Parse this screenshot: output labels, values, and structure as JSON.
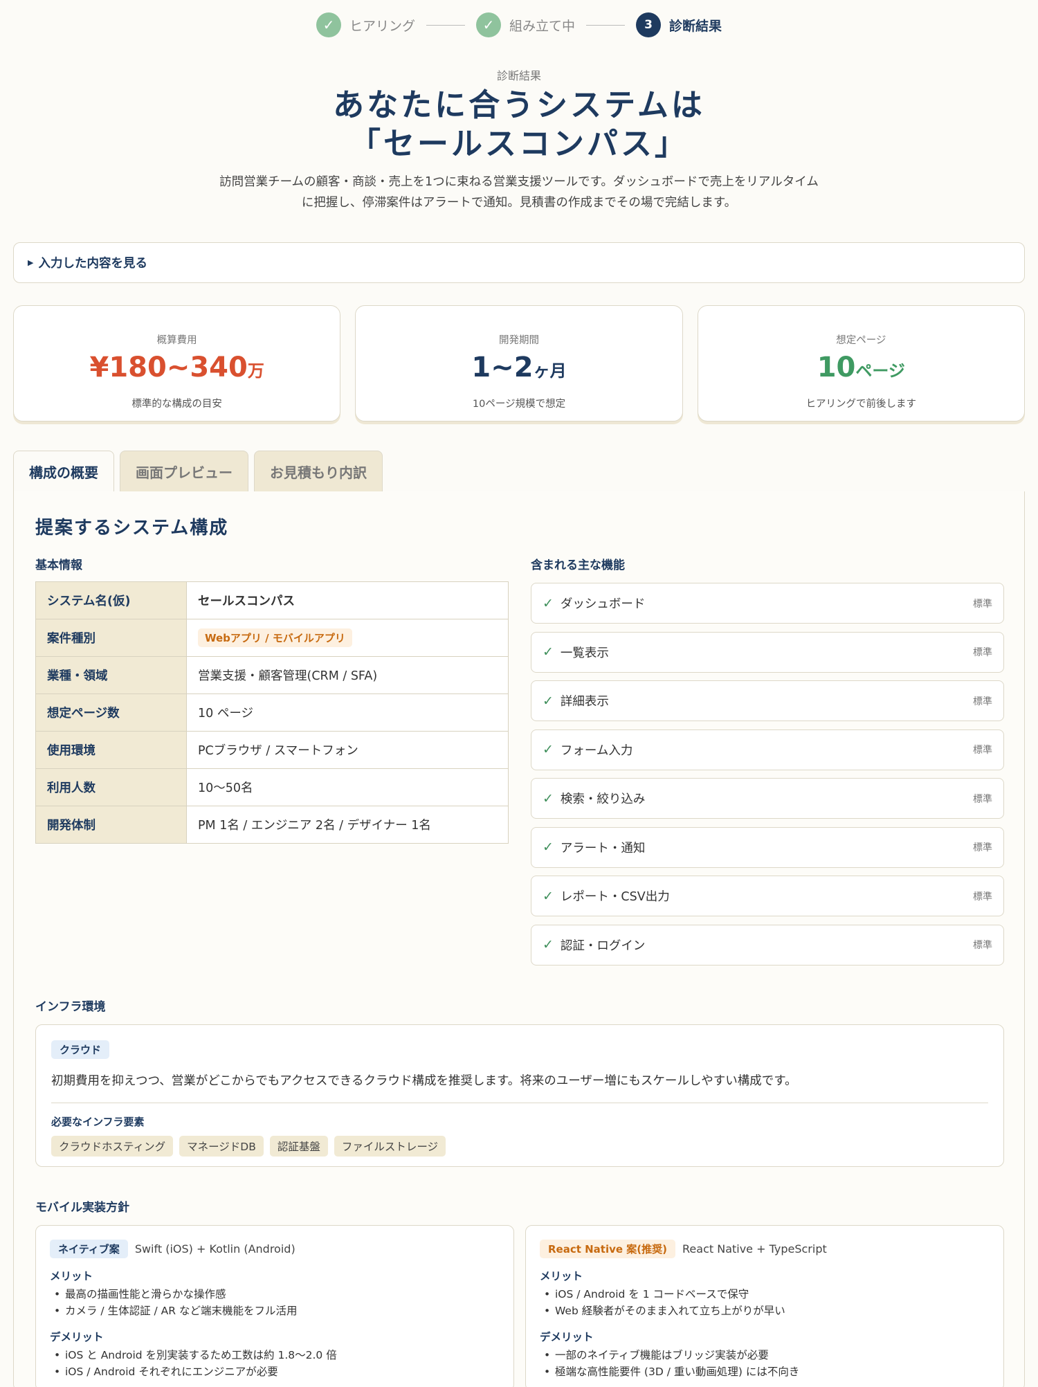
{
  "stepper": {
    "steps": [
      {
        "label": "ヒアリング",
        "mark": "✓"
      },
      {
        "label": "組み立て中",
        "mark": "✓"
      },
      {
        "label": "診断結果",
        "mark": "3"
      }
    ]
  },
  "hero": {
    "eyebrow": "診断結果",
    "title_line1": "あなたに合うシステムは",
    "title_line2": "「セールスコンパス」",
    "description": "訪問営業チームの顧客・商談・売上を1つに束ねる営業支援ツールです。ダッシュボードで売上をリアルタイムに把握し、停滞案件はアラートで通知。見積書の作成までその場で完結します。"
  },
  "accordion": {
    "label": "入力した内容を見る"
  },
  "summary_cards": [
    {
      "label": "概算費用",
      "value": "¥180~340",
      "unit": "万",
      "note": "標準的な構成の目安",
      "color": "#d9502f"
    },
    {
      "label": "開発期間",
      "value": "1~2",
      "unit": "ヶ月",
      "note": "10ページ規模で想定",
      "color": "#1e3a5f"
    },
    {
      "label": "想定ページ",
      "value": "10",
      "unit": "ページ",
      "note": "ヒアリングで前後します",
      "color": "#3f9a62"
    }
  ],
  "tabs": [
    "構成の概要",
    "画面プレビュー",
    "お見積もり内訳"
  ],
  "overview": {
    "title": "提案するシステム構成",
    "basic_info_heading": "基本情報",
    "basic_info": [
      {
        "key": "システム名(仮)",
        "value": "セールスコンパス"
      },
      {
        "key": "案件種別",
        "value": "Webアプリ / モバイルアプリ"
      },
      {
        "key": "業種・領域",
        "value": "営業支援・顧客管理(CRM / SFA)"
      },
      {
        "key": "想定ページ数",
        "value": "10 ページ"
      },
      {
        "key": "使用環境",
        "value": "PCブラウザ / スマートフォン"
      },
      {
        "key": "利用人数",
        "value": "10〜50名"
      },
      {
        "key": "開発体制",
        "value": "PM 1名 / エンジニア 2名 / デザイナー 1名"
      }
    ],
    "features_heading": "含まれる主な機能",
    "features": [
      {
        "name": "ダッシュボード",
        "tag": "標準"
      },
      {
        "name": "一覧表示",
        "tag": "標準"
      },
      {
        "name": "詳細表示",
        "tag": "標準"
      },
      {
        "name": "フォーム入力",
        "tag": "標準"
      },
      {
        "name": "検索・絞り込み",
        "tag": "標準"
      },
      {
        "name": "アラート・通知",
        "tag": "標準"
      },
      {
        "name": "レポート・CSV出力",
        "tag": "標準"
      },
      {
        "name": "認証・ログイン",
        "tag": "標準"
      }
    ]
  },
  "infra": {
    "heading": "インフラ環境",
    "type": "クラウド",
    "description": "初期費用を抑えつつ、営業がどこからでもアクセスできるクラウド構成を推奨します。将来のユーザー増にもスケールしやすい構成です。",
    "required_heading": "必要なインフラ要素",
    "elements": [
      "クラウドホスティング",
      "マネージドDB",
      "認証基盤",
      "ファイルストレージ"
    ]
  },
  "mobile": {
    "heading": "モバイル実装方針",
    "options": [
      {
        "badge": "ネイティブ案",
        "stack": "Swift (iOS) + Kotlin (Android)",
        "merits_label": "メリット",
        "merits": [
          "最高の描画性能と滑らかな操作感",
          "カメラ / 生体認証 / AR など端末機能をフル活用"
        ],
        "demerits_label": "デメリット",
        "demerits": [
          "iOS と Android を別実装するため工数は約 1.8〜2.0 倍",
          "iOS / Android それぞれにエンジニアが必要"
        ]
      },
      {
        "badge": "React Native 案(推奨)",
        "stack": "React Native + TypeScript",
        "merits_label": "メリット",
        "merits": [
          "iOS / Android を 1 コードベースで保守",
          "Web 経験者がそのまま入れて立ち上がりが早い"
        ],
        "demerits_label": "デメリット",
        "demerits": [
          "一部のネイティブ機能はブリッジ実装が必要",
          "極端な高性能要件 (3D / 重い動画処理) には不向き"
        ]
      }
    ]
  }
}
